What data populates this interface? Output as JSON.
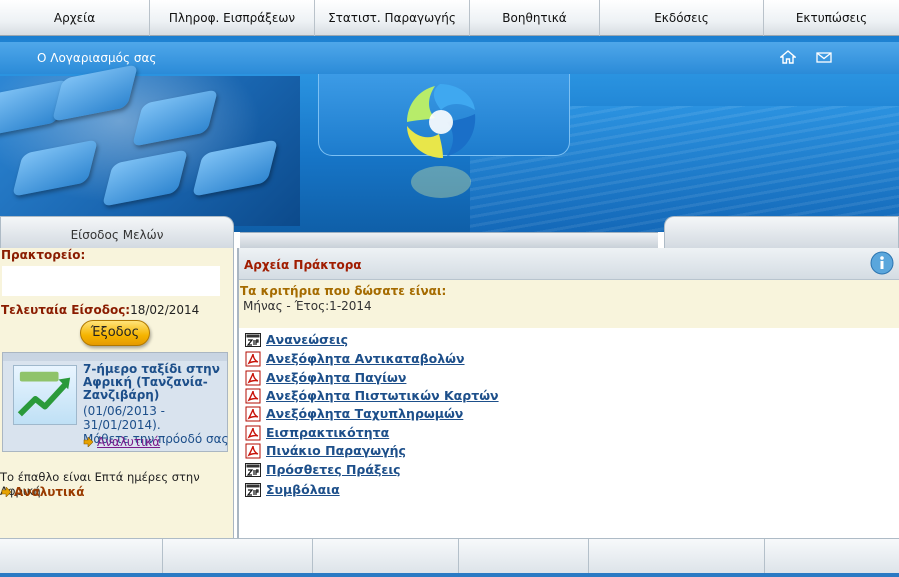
{
  "topnav": {
    "items": [
      {
        "label": "Αρχεία"
      },
      {
        "label": "Πληροφ. Εισπράξεων"
      },
      {
        "label": "Στατιστ. Παραγωγής"
      },
      {
        "label": "Βοηθητικά"
      },
      {
        "label": "Εκδόσεις"
      },
      {
        "label": "Εκτυπώσεις"
      }
    ]
  },
  "header": {
    "account_link": "Ο Λογαριασμός σας",
    "icons": [
      "home-icon",
      "mail-icon"
    ]
  },
  "sidebar": {
    "tab_label": "Είσοδος Μελών",
    "agency_label": "Πρακτορείο:",
    "last_login_label": "Τελευταία Είσοδος:",
    "last_login_value": "18/02/2014",
    "logout_label": "Έξοδος",
    "promo": {
      "title": "7-ήμερο ταξίδι στην Αφρική (Τανζανία-Ζανζιβάρη)",
      "dates": "(01/06/2013 - 31/01/2014).",
      "tagline": "Μάθετε την πρόοδό σας",
      "link": "Αναλυτικά"
    },
    "prize_text": "Το έπαθλο είναι Επτά ημέρες στην Αφρική",
    "prize_link": "Αναλυτικά"
  },
  "main": {
    "title": "Αρχεία Πράκτορα",
    "criteria_title": "Τα κριτήρια που δώσατε είναι:",
    "criteria_value": "Μήνας - Έτος:1-2014",
    "documents": [
      {
        "label": "Ανανεώσεις",
        "icon": "zip-icon"
      },
      {
        "label": "Ανεξόφλητα Αντικαταβολών",
        "icon": "pdf-icon"
      },
      {
        "label": "Ανεξόφλητα Παγίων",
        "icon": "pdf-icon"
      },
      {
        "label": "Ανεξόφλητα Πιστωτικών Καρτών",
        "icon": "pdf-icon"
      },
      {
        "label": "Ανεξόφλητα Ταχυπληρωμών",
        "icon": "pdf-icon"
      },
      {
        "label": "Εισπρακτικότητα",
        "icon": "pdf-icon"
      },
      {
        "label": "Πινάκιο Παραγωγής",
        "icon": "pdf-icon"
      },
      {
        "label": "Πρόσθετες  Πράξεις",
        "icon": "zip-icon"
      },
      {
        "label": "Συμβόλαια",
        "icon": "zip-icon"
      }
    ]
  },
  "colors": {
    "accent_blue": "#1d4f8a",
    "heading_red": "#a01c00",
    "sidebar_bg": "#f8f4dc",
    "button_yellow": "#f5b400"
  }
}
